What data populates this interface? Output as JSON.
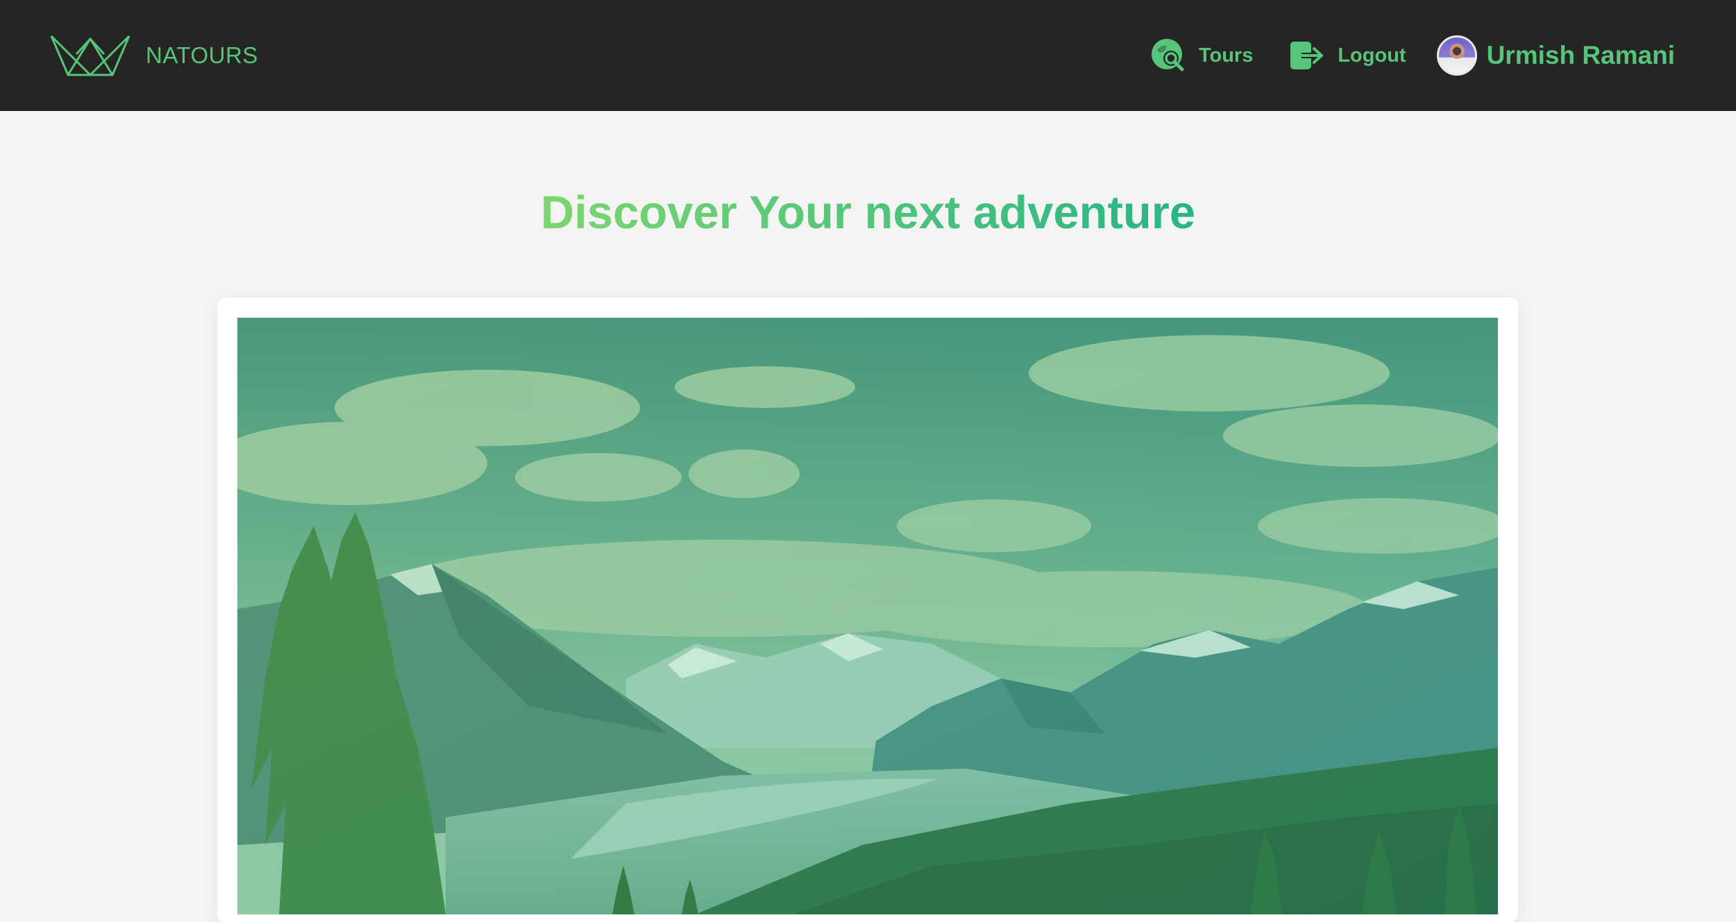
{
  "header": {
    "brand_name": "NATOURS",
    "nav": [
      {
        "label": "Tours",
        "icon": "tour-search-icon"
      },
      {
        "label": "Logout",
        "icon": "logout-icon"
      }
    ],
    "user": {
      "name": "Urmish Ramani"
    }
  },
  "main": {
    "heading": "Discover Your next adventure"
  },
  "theme": {
    "accent": "#55c57a",
    "nav_bg": "#272424",
    "page_bg": "#f4f4f4"
  }
}
